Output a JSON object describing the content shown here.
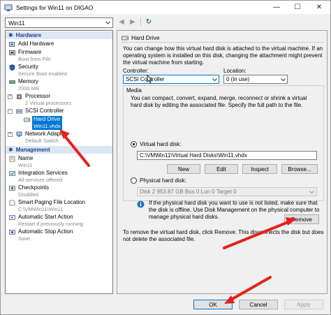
{
  "window": {
    "title": "Settings for Win11 on DIGAO",
    "minimize": "—",
    "maximize": "☐",
    "close": "✕"
  },
  "vm_selector": {
    "value": "Win11"
  },
  "nav": {
    "back": "◀",
    "forward": "▶",
    "refresh": "↻"
  },
  "sidebar": {
    "hardware_header": "Hardware",
    "management_header": "Management",
    "hardware": [
      {
        "label": "Add Hardware",
        "sub": "",
        "icon": "add-hardware-icon"
      },
      {
        "label": "Firmware",
        "sub": "Boot from File",
        "icon": "firmware-icon"
      },
      {
        "label": "Security",
        "sub": "Secure Boot enabled",
        "icon": "security-shield-icon"
      },
      {
        "label": "Memory",
        "sub": "2000 MB",
        "icon": "memory-icon"
      },
      {
        "label": "Processor",
        "sub": "2 Virtual processors",
        "icon": "processor-icon"
      },
      {
        "label": "SCSI Controller",
        "sub": "",
        "icon": "scsi-controller-icon"
      },
      {
        "label": "Hard Drive",
        "sub": "Win11.vhdx",
        "icon": "hard-drive-icon"
      },
      {
        "label": "Network Adapter",
        "sub": "Default Switch",
        "icon": "network-adapter-icon"
      }
    ],
    "management": [
      {
        "label": "Name",
        "sub": "Win11",
        "icon": "name-icon"
      },
      {
        "label": "Integration Services",
        "sub": "All services offered",
        "icon": "integration-services-icon"
      },
      {
        "label": "Checkpoints",
        "sub": "Disabled",
        "icon": "checkpoints-icon"
      },
      {
        "label": "Smart Paging File Location",
        "sub": "C:\\VMWin11\\Win11",
        "icon": "paging-file-icon"
      },
      {
        "label": "Automatic Start Action",
        "sub": "Restart if previously running",
        "icon": "auto-start-icon"
      },
      {
        "label": "Automatic Stop Action",
        "sub": "Save",
        "icon": "auto-stop-icon"
      }
    ]
  },
  "main": {
    "heading": "Hard Drive",
    "description": "You can change how this virtual hard disk is attached to the virtual machine. If an operating system is installed on this disk, changing the attachment might prevent the virtual machine from starting.",
    "controller_label": "Controller:",
    "controller_value": "SCSI Controller",
    "location_label": "Location:",
    "location_value": "0 (in use)",
    "media_title": "Media",
    "media_desc": "You can compact, convert, expand, merge, reconnect or shrink a virtual hard disk by editing the associated file. Specify the full path to the file.",
    "vhd_radio": "Virtual hard disk:",
    "vhd_path": "C:\\VMWin11\\Virtual Hard Disks\\Win11.vhdx",
    "btn_new": "New",
    "btn_edit": "Edit",
    "btn_inspect": "Inspect",
    "btn_browse": "Browse...",
    "phys_radio": "Physical hard disk:",
    "phys_value": "Disk 2 953.87 GB Bus 0 Lun 0 Target 0",
    "info_text": "If the physical hard disk you want to use is not listed, make sure that the disk is offline. Use Disk Management on the physical computer to manage physical hard disks.",
    "remove_text": "To remove the virtual hard disk, click Remove. This disconnects the disk but does not delete the associated file.",
    "btn_remove": "Remove"
  },
  "footer": {
    "ok": "OK",
    "cancel": "Cancel",
    "apply": "Apply"
  },
  "colors": {
    "selection": "#0078d7",
    "section_bg": "#dce6f4",
    "section_text": "#1f3f8f",
    "arrow": "#e5211d"
  }
}
